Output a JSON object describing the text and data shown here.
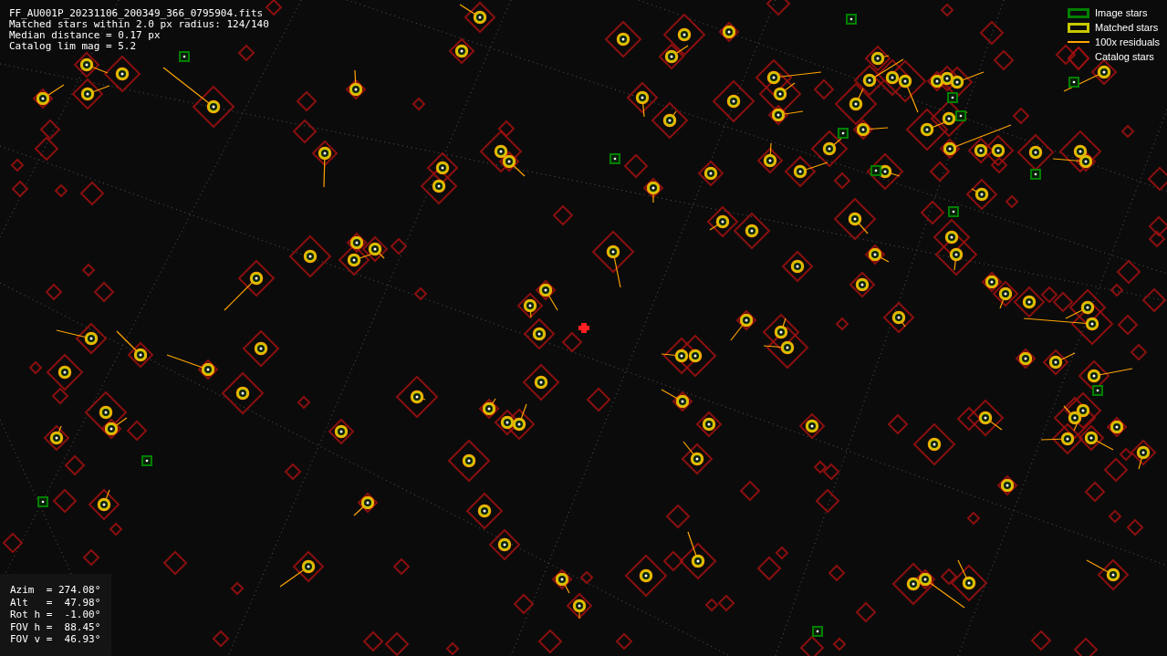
{
  "info": [
    "FF_AU001P_20231106_200349_366_0795904.fits",
    "Matched stars within 2.0 px radius: 124/140",
    "Median distance = 0.17 px",
    "Catalog lim mag = 5.2"
  ],
  "legend": [
    {
      "kind": "image",
      "label": "Image stars",
      "color": "#008000"
    },
    {
      "kind": "matched",
      "label": "Matched stars",
      "color": "#c8c800"
    },
    {
      "kind": "residual",
      "label": "100x residuals",
      "color": "#ffa500"
    },
    {
      "kind": "catalog",
      "label": "Catalog stars",
      "color": "#a01010"
    }
  ],
  "pointing": [
    "Azim  = 274.08°",
    "Alt   =  47.98°",
    "Rot h =  -1.00°",
    "FOV h =  88.45°",
    "FOV v =  46.93°"
  ]
}
